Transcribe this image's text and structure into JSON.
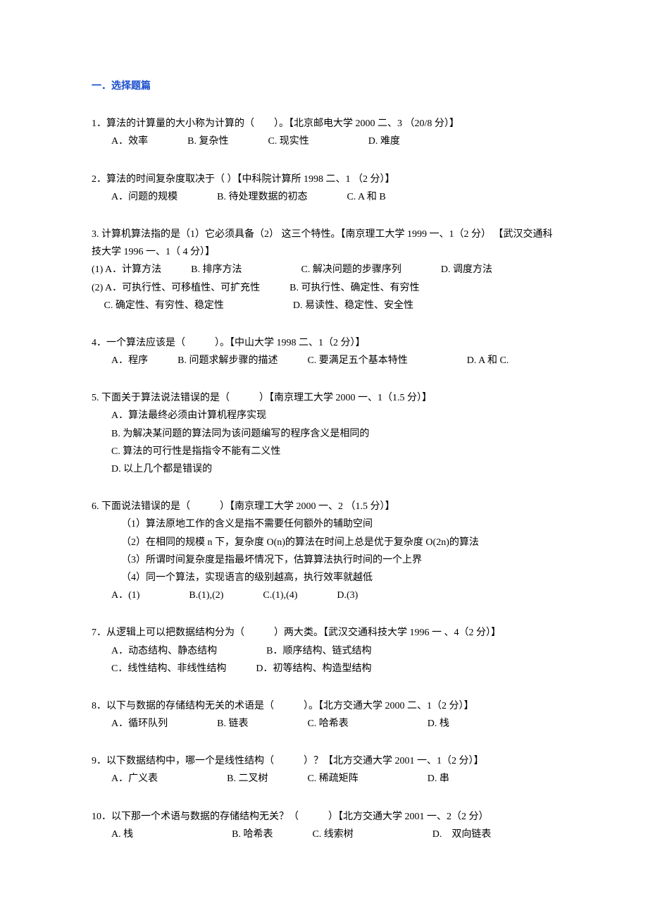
{
  "section_title": "一．选择题篇",
  "questions": {
    "q1": {
      "text": "1．算法的计算量的大小称为计算的（　　）。【北京邮电大学 2000 二、3 （20/8 分）】",
      "options": "A．效率　　　　B. 复杂性　　　　C. 现实性　　　　　　D. 难度"
    },
    "q2": {
      "text": "2．算法的时间复杂度取决于（ ）【中科院计算所 1998 二、1 （2 分）】",
      "options": "A．问题的规模　　　　B. 待处理数据的初态　　　　C. A 和 B"
    },
    "q3": {
      "text1": "3. 计算机算法指的是（1）它必须具备（2） 这三个特性。【南京理工大学 1999 一、1（2 分） 【武汉交通科技大学 1996 一、1（ 4 分）】",
      "opt1": "(1) A．计算方法　　　B. 排序方法　　　　　　C. 解决问题的步骤序列　　　　D. 调度方法",
      "opt2": "(2) A．可执行性、可移植性、可扩充性　　　B. 可执行性、确定性、有穷性",
      "opt3": "　 C. 确定性、有穷性、稳定性　　　　　　　D. 易读性、稳定性、安全性"
    },
    "q4": {
      "text": "4．一个算法应该是（　　　）。【中山大学 1998 二、1（2 分）】",
      "options": "　　A．程序　　　B. 问题求解步骤的描述　　　C. 要满足五个基本特性　　　　　　D. A 和 C."
    },
    "q5": {
      "text": "5. 下面关于算法说法错误的是（　　　）【南京理工大学 2000 一、1（1.5 分）】",
      "optA": "A．算法最终必须由计算机程序实现",
      "optB": "B. 为解决某问题的算法同为该问题编写的程序含义是相同的",
      "optC": "C. 算法的可行性是指指令不能有二义性",
      "optD": "D. 以上几个都是错误的"
    },
    "q6": {
      "text": "6. 下面说法错误的是（　　　）【南京理工大学 2000 一、2 （1.5 分）】",
      "l1": "（1）算法原地工作的含义是指不需要任何额外的辅助空间",
      "l2": "（2）在相同的规模 n 下，复杂度 O(n)的算法在时间上总是优于复杂度 O(2n)的算法",
      "l3": "（3）所谓时间复杂度是指最坏情况下，估算算法执行时间的一个上界",
      "l4": "（4）同一个算法，实现语言的级别越高，执行效率就越低",
      "options": "A．(1)　　　　　B.(1),(2)　　　　C.(1),(4)　　　　D.(3)"
    },
    "q7": {
      "text": "7．从逻辑上可以把数据结构分为（　　　）两大类。【武汉交通科技大学 1996 一 、4（2 分）】",
      "optAB": "A．动态结构、静态结构　　　　　B．顺序结构、链式结构",
      "optCD": "C．线性结构、非线性结构　　　D．初等结构、构造型结构"
    },
    "q8": {
      "text": "8．以下与数据的存储结构无关的术语是（　　　）。【北方交通大学 2000 二、1（2 分）】",
      "options": "A．循环队列　　　　　B. 链表　　　　　　C. 哈希表　　　　　　　　D.  栈"
    },
    "q9": {
      "text": "9．以下数据结构中，哪一个是线性结构（　　　）？【北方交通大学 2001 一、1（2 分）】",
      "options": "A．广义表　　　　　　　B. 二叉树　　　　C. 稀疏矩阵　　　　　　　D.  串"
    },
    "q10": {
      "text": "10．以下那一个术语与数据的存储结构无关？（　　　）【北方交通大学 2001 一、2（2 分）",
      "options": "A. 栈　　　　　　　　　　B. 哈希表　　　　C. 线索树　　　　　　　　D.　双向链表"
    }
  }
}
